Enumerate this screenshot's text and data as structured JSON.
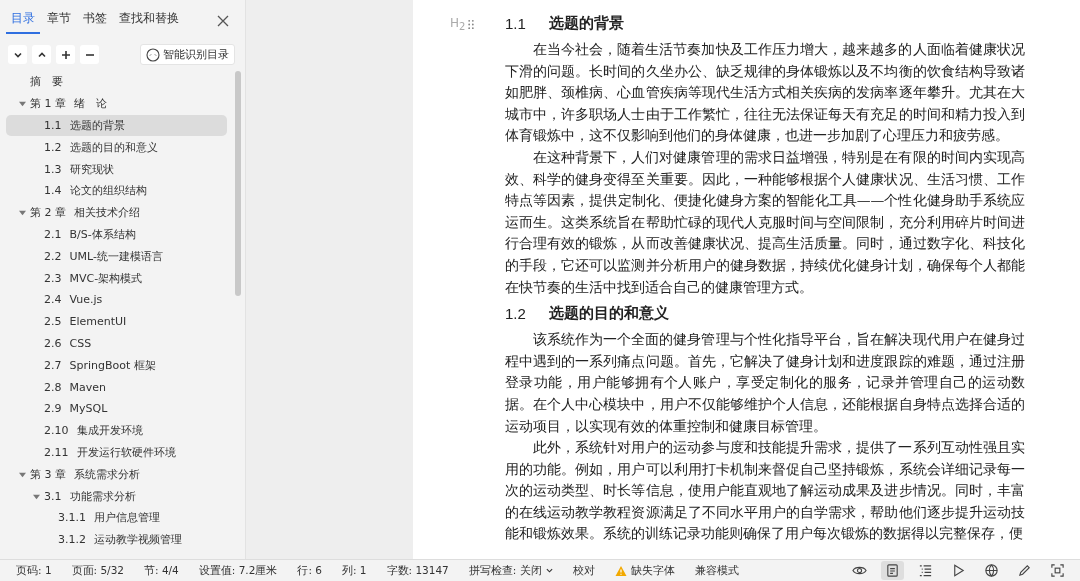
{
  "sidebar": {
    "tabs": [
      {
        "label": "目录",
        "selected": true
      },
      {
        "label": "章节",
        "selected": false
      },
      {
        "label": "书签",
        "selected": false
      },
      {
        "label": "查找和替换",
        "selected": false
      }
    ],
    "smart_button": "智能识别目录",
    "outline": [
      {
        "title": "摘　要",
        "selected": false
      },
      {
        "num": "第 1 章",
        "title": "绪　论",
        "selected": false,
        "expanded": true,
        "children": [
          {
            "num": "1.1",
            "title": "选题的背景",
            "selected": true
          },
          {
            "num": "1.2",
            "title": "选题的目的和意义",
            "selected": false
          },
          {
            "num": "1.3",
            "title": "研究现状",
            "selected": false
          },
          {
            "num": "1.4",
            "title": "论文的组织结构",
            "selected": false
          }
        ]
      },
      {
        "num": "第 2 章",
        "title": "相关技术介绍",
        "selected": false,
        "expanded": true,
        "children": [
          {
            "num": "2.1",
            "title": "B/S-体系结构",
            "selected": false
          },
          {
            "num": "2.2",
            "title": "UML-统一建模语言",
            "selected": false
          },
          {
            "num": "2.3",
            "title": "MVC-架构模式",
            "selected": false
          },
          {
            "num": "2.4",
            "title": "Vue.js",
            "selected": false
          },
          {
            "num": "2.5",
            "title": "ElementUI",
            "selected": false
          },
          {
            "num": "2.6",
            "title": "CSS",
            "selected": false
          },
          {
            "num": "2.7",
            "title": "SpringBoot 框架",
            "selected": false
          },
          {
            "num": "2.8",
            "title": "Maven",
            "selected": false
          },
          {
            "num": "2.9",
            "title": "MySQL",
            "selected": false
          },
          {
            "num": "2.10",
            "title": "集成开发环境",
            "selected": false
          },
          {
            "num": "2.11",
            "title": "开发运行软硬件环境",
            "selected": false
          }
        ]
      },
      {
        "num": "第 3 章",
        "title": "系统需求分析",
        "selected": false,
        "expanded": true,
        "children": [
          {
            "num": "3.1",
            "title": "功能需求分析",
            "selected": false,
            "expanded": true,
            "children": [
              {
                "num": "3.1.1",
                "title": "用户信息管理",
                "selected": false
              },
              {
                "num": "3.1.2",
                "title": "运动教学视频管理",
                "selected": false
              }
            ]
          }
        ]
      }
    ]
  },
  "document": {
    "heading_marker": "H$_{2}$",
    "blocks": [
      {
        "kind": "heading",
        "num": "1.1",
        "title": "选题的背景"
      },
      {
        "kind": "paragraph",
        "text": "在当今社会，随着生活节奏加快及工作压力增大，越来越多的人面临着健康状况下滑的问题。长时间的久坐办公、缺乏规律的身体锻炼以及不均衡的饮食结构导致诸如肥胖、颈椎病、心血管疾病等现代生活方式相关疾病的发病率逐年攀升。尤其在大城市中，许多职场人士由于工作繁忙，往往无法保证每天有充足的时间和精力投入到体育锻炼中，这不仅影响到他们的身体健康，也进一步加剧了心理压力和疲劳感。"
      },
      {
        "kind": "paragraph",
        "text": "在这种背景下，人们对健康管理的需求日益增强，特别是在有限的时间内实现高效、科学的健身变得至关重要。因此，一种能够根据个人健康状况、生活习惯、工作特点等因素，提供定制化、便捷化健身方案的智能化工具——个性化健身助手系统应运而生。这类系统旨在帮助忙碌的现代人克服时间与空间限制，充分利用碎片时间进行合理有效的锻炼，从而改善健康状况、提高生活质量。同时，通过数字化、科技化的手段，它还可以监测并分析用户的健身数据，持续优化健身计划，确保每个人都能在快节奏的生活中找到适合自己的健康管理方式。"
      },
      {
        "kind": "heading",
        "num": "1.2",
        "title": "选题的目的和意义"
      },
      {
        "kind": "paragraph",
        "text": "该系统作为一个全面的健身管理与个性化指导平台，旨在解决现代用户在健身过程中遇到的一系列痛点问题。首先，它解决了健身计划和进度跟踪的难题，通过注册登录功能，用户能够拥有个人账户，享受定制化的服务，记录并管理自己的运动数据。在个人中心模块中，用户不仅能够维护个人信息，还能根据自身特点选择合适的运动项目，以实现有效的体重控制和健康目标管理。"
      },
      {
        "kind": "paragraph",
        "text": "此外，系统针对用户的运动参与度和技能提升需求，提供了一系列互动性强且实用的功能。例如，用户可以利用打卡机制来督促自己坚持锻炼，系统会详细记录每一次的运动类型、时长等信息，使用户能直观地了解运动成果及进步情况。同时，丰富的在线运动教学教程资源满足了不同水平用户的自学需求，帮助他们逐步提升运动技能和锻炼效果。系统的训练记录功能则确保了用户每次锻炼的数据得以完整保存，便"
      }
    ]
  },
  "status_bar": {
    "items": [
      {
        "kind": "text",
        "label": "页码: 1"
      },
      {
        "kind": "text",
        "label": "页面: 5/32"
      },
      {
        "kind": "text",
        "label": "节: 4/4"
      },
      {
        "kind": "text",
        "label": "设置值: 7.2厘米"
      },
      {
        "kind": "text",
        "label": "行: 6"
      },
      {
        "kind": "text",
        "label": "列: 1"
      },
      {
        "kind": "text",
        "label": "字数: 13147"
      },
      {
        "kind": "dropdown",
        "label": "拼写检查: 关闭"
      },
      {
        "kind": "button",
        "label": "校对"
      },
      {
        "kind": "warning",
        "label": "缺失字体"
      },
      {
        "kind": "button",
        "label": "兼容模式"
      }
    ],
    "views": [
      {
        "kind": "eye",
        "selected": false
      },
      {
        "kind": "page",
        "selected": true
      },
      {
        "kind": "outline",
        "selected": false
      },
      {
        "kind": "play",
        "selected": false
      },
      {
        "kind": "globe",
        "selected": false
      },
      {
        "kind": "pen",
        "selected": false
      },
      {
        "kind": "focus",
        "selected": false
      }
    ]
  }
}
